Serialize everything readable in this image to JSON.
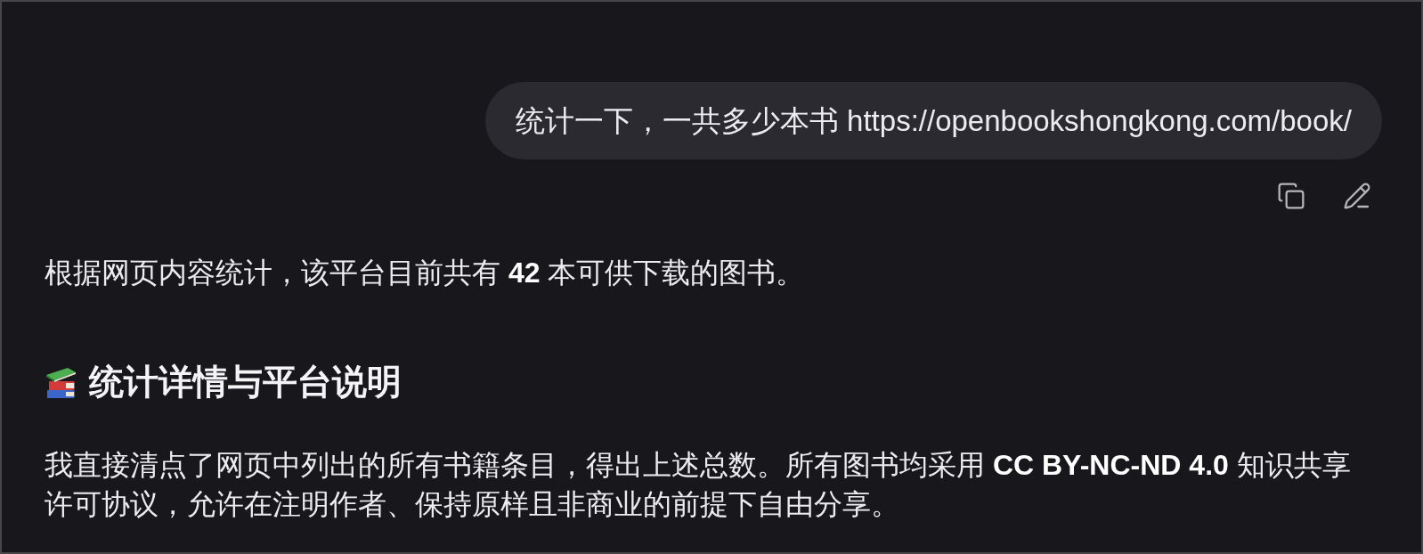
{
  "user_message": {
    "text": "统计一下，一共多少本书 https://openbookshongkong.com/book/"
  },
  "response": {
    "blocks": [
      {
        "kind": "paragraph",
        "text": "根据网页内容统计，该平台目前共有 **42** 本可供下载的图书。"
      },
      {
        "kind": "heading",
        "text": "统计详情与平台说明"
      },
      {
        "kind": "paragraph",
        "text": "我直接清点了网页中列出的所有书籍条目，得出上述总数。所有图书均采用 **CC BY-NC-ND 4.0** 知识共享许可协议，允许在注明作者、保持原样且非商业的前提下自由分享。"
      }
    ]
  }
}
